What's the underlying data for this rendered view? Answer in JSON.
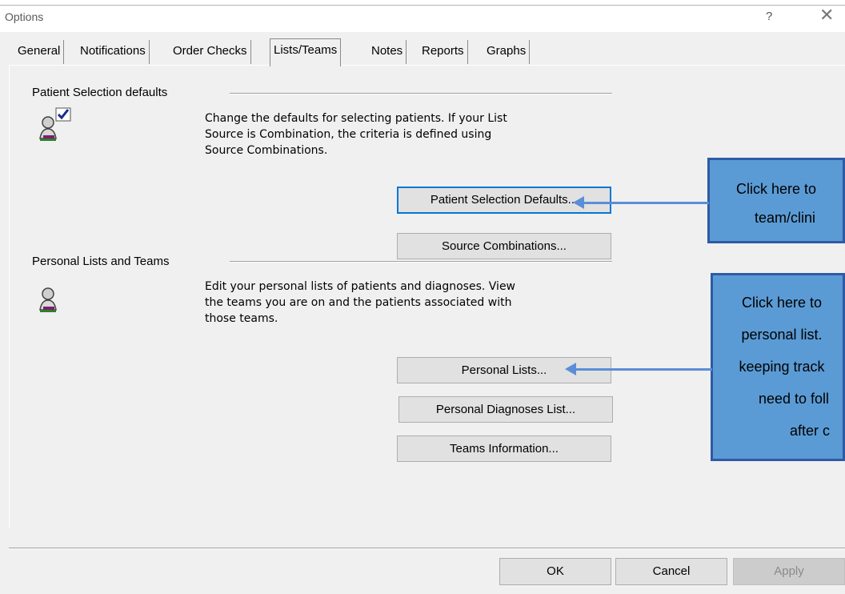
{
  "window": {
    "title": "Options",
    "help_label": "?",
    "close_label": "✕"
  },
  "tabs": [
    {
      "label": "General"
    },
    {
      "label": "Notifications"
    },
    {
      "label": "Order Checks"
    },
    {
      "label": "Lists/Teams"
    },
    {
      "label": "Notes"
    },
    {
      "label": "Reports"
    },
    {
      "label": "Graphs"
    }
  ],
  "active_tab": "Lists/Teams",
  "patient_selection": {
    "group_label": "Patient Selection defaults",
    "description_lines": [
      "Change the defaults for selecting patients. If your List",
      "Source is Combination, the criteria is defined using",
      "Source Combinations."
    ],
    "defaults_button": "Patient Selection Defaults...",
    "combinations_button": "Source Combinations..."
  },
  "personal_lists": {
    "group_label": "Personal Lists and Teams",
    "description_lines": [
      "Edit your personal lists of patients and diagnoses. View",
      "the teams you are on and the patients associated with",
      "those teams."
    ],
    "lists_button": "Personal Lists...",
    "diagnoses_button": "Personal Diagnoses List...",
    "teams_button": "Teams Information..."
  },
  "callouts": {
    "first_lines": [
      "Click here to",
      "team/clini"
    ],
    "second_lines": [
      "Click here to",
      "personal list.",
      "keeping track",
      "need to foll",
      "after c"
    ]
  },
  "footer": {
    "ok_label": "OK",
    "cancel_label": "Cancel",
    "apply_label": "Apply"
  },
  "colors": {
    "callout_fill": "#5b9bd5",
    "callout_border": "#2f5aa5",
    "focus_border": "#0078d7"
  }
}
